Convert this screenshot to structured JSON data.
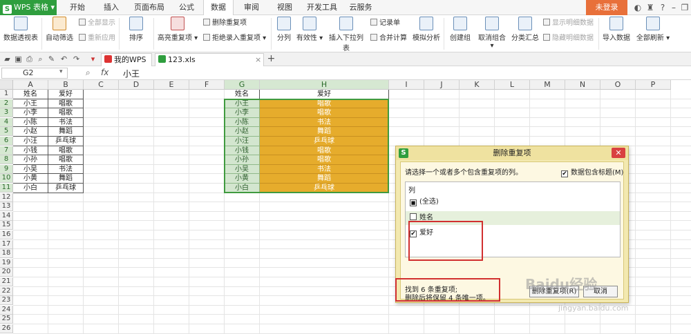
{
  "app": {
    "title": "WPS 表格",
    "logo": "S"
  },
  "menu": [
    "开始",
    "插入",
    "页面布局",
    "公式",
    "数据",
    "审阅",
    "视图",
    "开发工具",
    "云服务"
  ],
  "menu_active": 4,
  "login": "未登录",
  "ribbon": {
    "pivot": "数据透视表",
    "autofilter": "自动筛选",
    "show_all": "全部显示",
    "reapply": "重新应用",
    "sort": "排序",
    "highlight_dup": "高亮重复项",
    "delete_dup": "删除重复项",
    "reject_dup": "拒绝录入重复项",
    "split": "分列",
    "validity": "有效性",
    "insert_dropdown": "插入下拉列表",
    "record_form": "记录单",
    "merge_calc": "合并计算",
    "simulate": "模拟分析",
    "create_group": "创建组",
    "ungroup": "取消组合",
    "subtotal": "分类汇总",
    "show_detail": "显示明细数据",
    "hide_detail": "隐藏明细数据",
    "import": "导入数据",
    "refresh_all": "全部刷新"
  },
  "tabs": [
    {
      "label": "我的WPS"
    },
    {
      "label": "123.xls"
    }
  ],
  "namebox": "G2",
  "fx": "fx",
  "formula": "小王",
  "columns": [
    "A",
    "B",
    "C",
    "D",
    "E",
    "F",
    "G",
    "H",
    "I",
    "J",
    "K",
    "L",
    "M",
    "N",
    "O",
    "P"
  ],
  "rows": [
    "1",
    "2",
    "3",
    "4",
    "5",
    "6",
    "7",
    "8",
    "9",
    "10",
    "11",
    "12",
    "13",
    "14",
    "15",
    "16",
    "17",
    "18",
    "19",
    "20",
    "21",
    "22",
    "23",
    "24",
    "25",
    "26"
  ],
  "table_left": {
    "header": [
      "姓名",
      "爱好"
    ],
    "rows": [
      [
        "小王",
        "唱歌"
      ],
      [
        "小李",
        "唱歌"
      ],
      [
        "小陈",
        "书法"
      ],
      [
        "小赵",
        "舞蹈"
      ],
      [
        "小汪",
        "乒乓球"
      ],
      [
        "小钱",
        "唱歌"
      ],
      [
        "小孙",
        "唱歌"
      ],
      [
        "小吴",
        "书法"
      ],
      [
        "小黄",
        "舞蹈"
      ],
      [
        "小白",
        "乒乓球"
      ]
    ]
  },
  "table_right": {
    "header": [
      "姓名",
      "爱好"
    ],
    "rows": [
      [
        "小王",
        "唱歌"
      ],
      [
        "小李",
        "唱歌"
      ],
      [
        "小陈",
        "书法"
      ],
      [
        "小赵",
        "舞蹈"
      ],
      [
        "小汪",
        "乒乓球"
      ],
      [
        "小钱",
        "唱歌"
      ],
      [
        "小孙",
        "唱歌"
      ],
      [
        "小吴",
        "书法"
      ],
      [
        "小黄",
        "舞蹈"
      ],
      [
        "小白",
        "乒乓球"
      ]
    ]
  },
  "dialog": {
    "title": "删除重复项",
    "prompt": "请选择一个或者多个包含重复项的列。",
    "header_check": "数据包含标题(M)",
    "list_header": "列",
    "select_all": "(全选)",
    "items": [
      {
        "label": "姓名",
        "checked": false
      },
      {
        "label": "爱好",
        "checked": true
      }
    ],
    "result_line1": "找到 6 条重复项;",
    "result_line2": "删除后将保留 4 条唯一项。",
    "delete_btn": "删除重复项(R)",
    "cancel_btn": "取消"
  },
  "watermark": "Baidu经验",
  "watermark_url": "jingyan.baidu.com"
}
